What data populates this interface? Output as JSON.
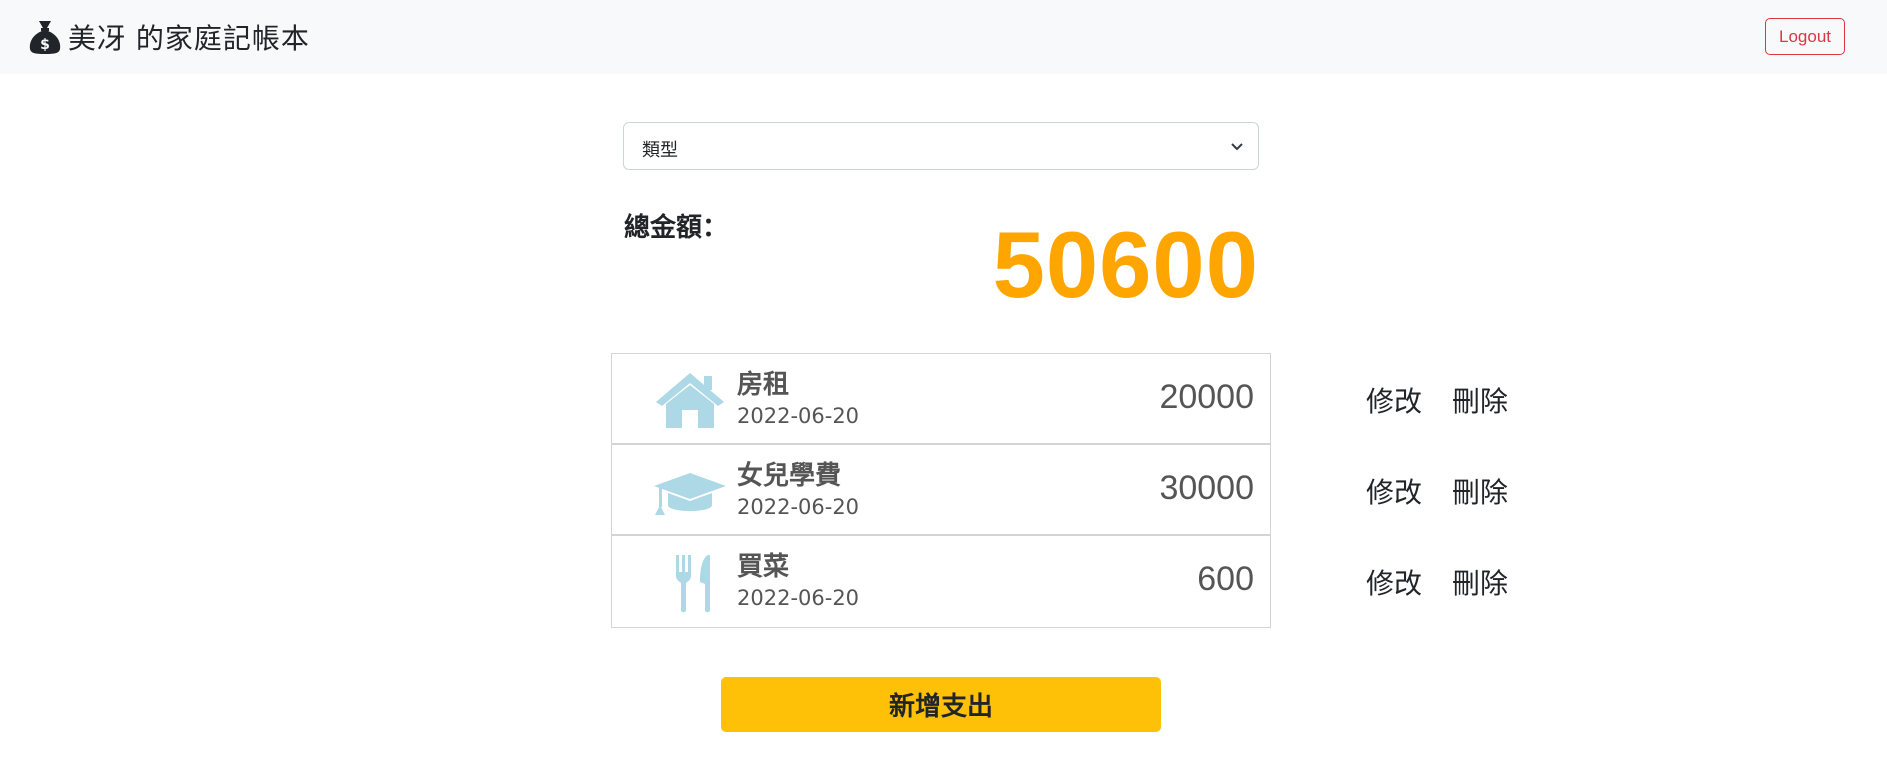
{
  "header": {
    "title": "美冴 的家庭記帳本",
    "logo_icon": "money-bag-icon",
    "logout_label": "Logout"
  },
  "filter": {
    "selected": "類型"
  },
  "summary": {
    "label": "總金額：",
    "amount": "50600",
    "amount_color": "#ffa500"
  },
  "expenses": [
    {
      "icon": "house-icon",
      "name": "房租",
      "date": "2022-06-20",
      "amount": "20000",
      "edit_label": "修改",
      "delete_label": "刪除"
    },
    {
      "icon": "graduation-cap-icon",
      "name": "女兒學費",
      "date": "2022-06-20",
      "amount": "30000",
      "edit_label": "修改",
      "delete_label": "刪除"
    },
    {
      "icon": "utensils-icon",
      "name": "買菜",
      "date": "2022-06-20",
      "amount": "600",
      "edit_label": "修改",
      "delete_label": "刪除"
    }
  ],
  "add_button": {
    "label": "新增支出",
    "color": "#ffc107"
  },
  "colors": {
    "icon_color": "#add8e6",
    "logout_color": "#dc3545"
  }
}
